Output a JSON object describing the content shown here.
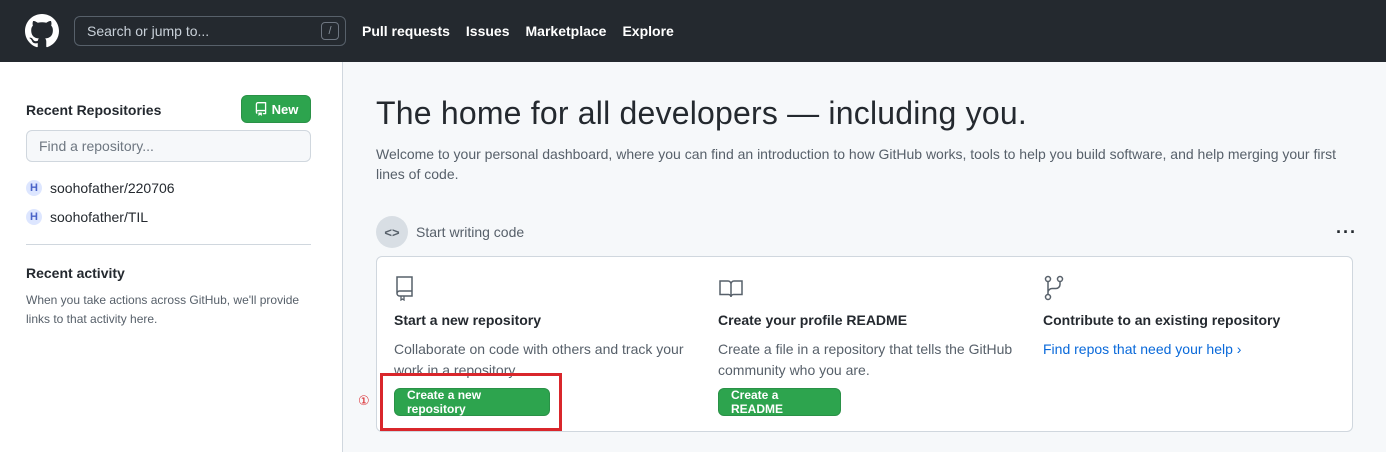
{
  "header": {
    "search_placeholder": "Search or jump to...",
    "search_shortcut": "/",
    "nav": [
      "Pull requests",
      "Issues",
      "Marketplace",
      "Explore"
    ]
  },
  "sidebar": {
    "recent_title": "Recent Repositories",
    "new_button": "New",
    "find_placeholder": "Find a repository...",
    "repos": [
      "soohofather/220706",
      "soohofather/TIL"
    ],
    "activity_title": "Recent activity",
    "activity_text": "When you take actions across GitHub, we'll provide links to that activity here."
  },
  "main": {
    "title": "The home for all developers — including you.",
    "subtitle": "Welcome to your personal dashboard, where you can find an introduction to how GitHub works, tools to help you build software, and help merging your first lines of code.",
    "section_label": "Start writing code",
    "cards": [
      {
        "title": "Start a new repository",
        "description": "Collaborate on code with others and track your work in a repository.",
        "button": "Create a new repository"
      },
      {
        "title": "Create your profile README",
        "description": "Create a file in a repository that tells the GitHub community who you are.",
        "button": "Create a README"
      },
      {
        "title": "Contribute to an existing repository",
        "link": "Find repos that need your help"
      }
    ]
  },
  "annotation": {
    "marker": "①",
    "color": "#d9262b"
  },
  "colors": {
    "header_bg": "#24292f",
    "primary_green": "#2da44e",
    "link_blue": "#0969da"
  }
}
